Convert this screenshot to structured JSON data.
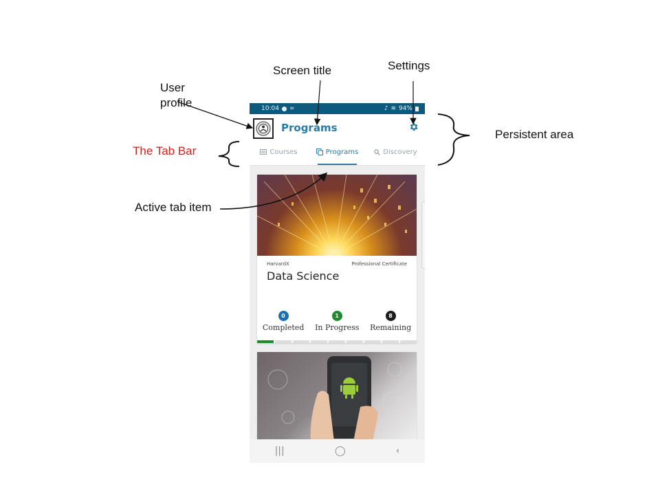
{
  "annotations": {
    "screen_title": "Screen title",
    "settings": "Settings",
    "user_profile_line1": "User",
    "user_profile_line2": "profile",
    "persistent_area": "Persistent area",
    "tab_bar": "The Tab Bar",
    "active_tab_item": "Active tab item"
  },
  "status_bar": {
    "time": "10:04",
    "battery": "94%"
  },
  "app_bar": {
    "title": "Programs",
    "settings_icon": "gear-icon",
    "avatar_icon": "avatar-icon"
  },
  "tabs": [
    {
      "label": "Courses",
      "icon": "book-icon",
      "active": false
    },
    {
      "label": "Programs",
      "icon": "copy-icon",
      "active": true
    },
    {
      "label": "Discovery",
      "icon": "search-icon",
      "active": false
    }
  ],
  "cards": [
    {
      "org": "HarvardX",
      "type": "Professional Certificate",
      "title": "Data Science",
      "stats": [
        {
          "value": "0",
          "label": "Completed",
          "color": "#1a6fb0"
        },
        {
          "value": "1",
          "label": "In Progress",
          "color": "#1f8b2c"
        },
        {
          "value": "8",
          "label": "Remaining",
          "color": "#1c1c1c"
        }
      ],
      "progress": {
        "completed": 1,
        "total": 9,
        "color": "#1f8b2c"
      }
    }
  ],
  "nav": {
    "recents": "|||",
    "home": "◯",
    "back": "‹"
  },
  "colors": {
    "brand": "#2c7ba7",
    "status_bar": "#0e5a7f",
    "annotation_red": "#d0201a"
  }
}
